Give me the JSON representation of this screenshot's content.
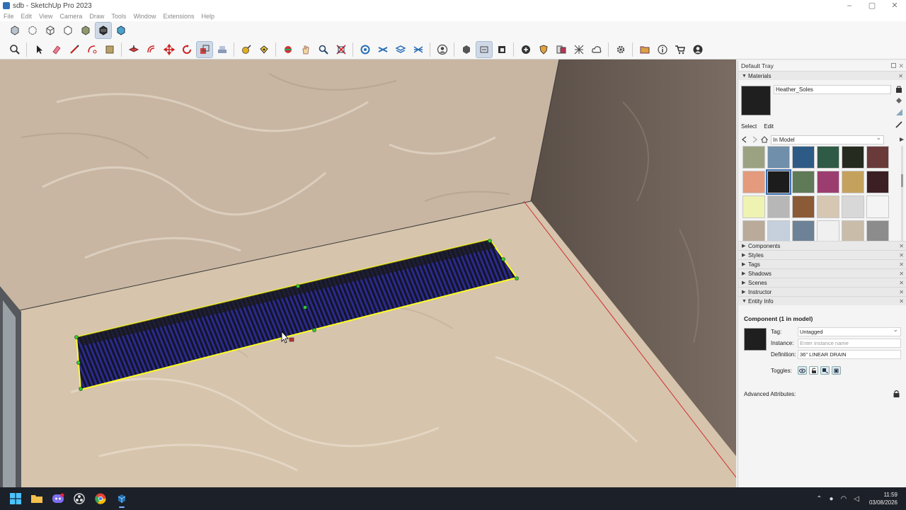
{
  "window": {
    "title": "sdb - SketchUp Pro 2023"
  },
  "menu": [
    "File",
    "Edit",
    "View",
    "Camera",
    "Draw",
    "Tools",
    "Window",
    "Extensions",
    "Help"
  ],
  "tray": {
    "title": "Default Tray",
    "materials": {
      "header": "Materials",
      "current_material": "Heather_Soles",
      "tabs": {
        "select": "Select",
        "edit": "Edit"
      },
      "collection": "In Model",
      "swatch_colors": [
        "#9aa282",
        "#6f8fab",
        "#2e5b85",
        "#2f5a46",
        "#252b1f",
        "#6a3a3b",
        "#e49a7c",
        "#1c1c1c",
        "#5e7a57",
        "#9c3d6f",
        "#c4a25e",
        "#3c1f22",
        "#eef3b2",
        "#b7b7b7",
        "#8b5a36",
        "#d6c7b2",
        "#d8d8d8",
        "#f4f4f4",
        "#b9aa9a",
        "#c5d0dc",
        "#6d8296",
        "#f0f0f0",
        "#c9bca9",
        "#8c8c8c"
      ],
      "selected_index": 7
    },
    "panels": [
      "Components",
      "Styles",
      "Tags",
      "Shadows",
      "Scenes",
      "Instructor"
    ],
    "entity_info": {
      "header": "Entity Info",
      "component_title": "Component (1 in model)",
      "tag_label": "Tag:",
      "tag_value": "Untagged",
      "instance_label": "Instance:",
      "instance_placeholder": "Enter instance name",
      "definition_label": "Definition:",
      "definition_value": "36\" LINEAR DRAIN",
      "toggles_label": "Toggles:",
      "advanced": "Advanced Attributes:"
    }
  },
  "taskbar": {
    "time": "11:59",
    "date": "03/08/2026"
  }
}
